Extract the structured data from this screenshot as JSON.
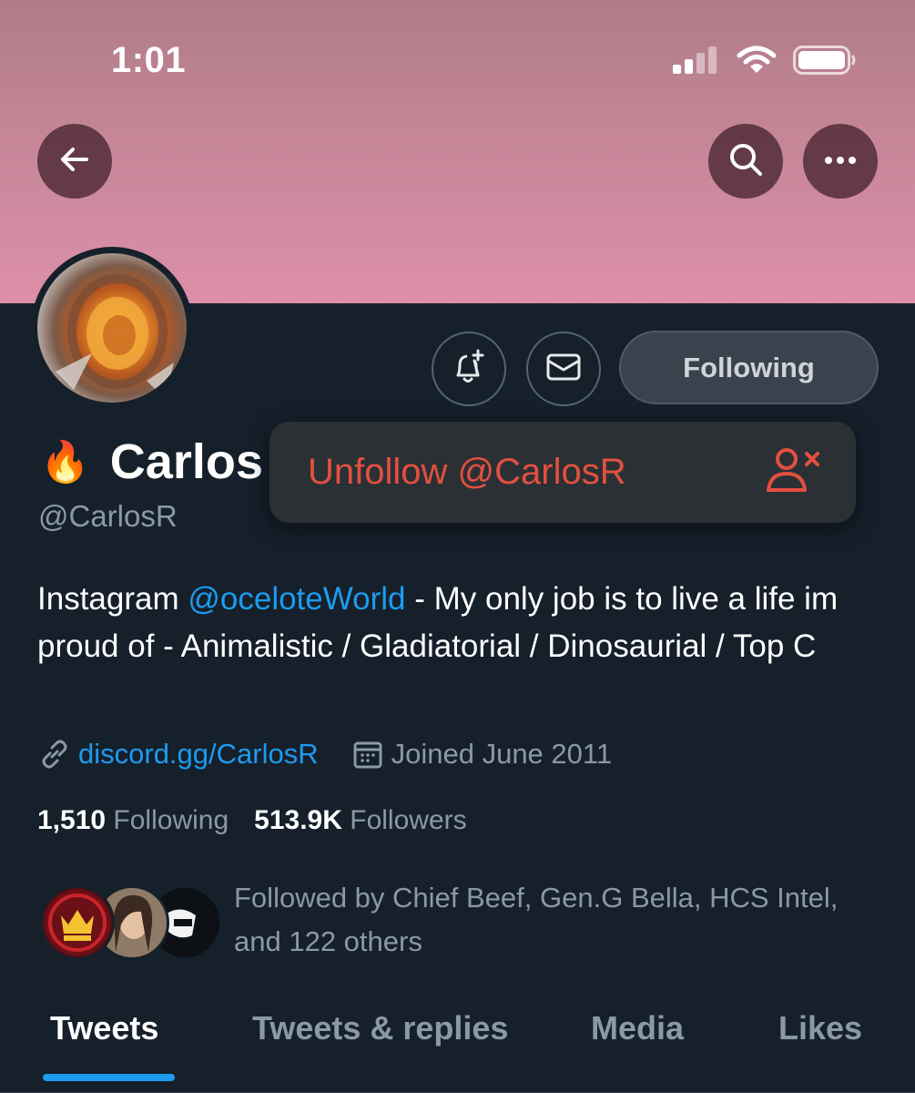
{
  "status_bar": {
    "time": "1:01",
    "icons": [
      "cellular-signal-icon",
      "wifi-icon",
      "battery-icon"
    ]
  },
  "colors": {
    "background": "#15202b",
    "banner": "#c9889b",
    "accent": "#1d9bf0",
    "danger": "#e3503f",
    "muted": "#8b98a5"
  },
  "header": {
    "back_icon": "arrow-left-icon",
    "search_icon": "search-icon",
    "more_icon": "more-horizontal-icon"
  },
  "profile": {
    "name_emoji": "🔥",
    "name": "Carlos",
    "handle": "@CarlosR",
    "bio_prefix": "Instagram ",
    "bio_mention": "@oceloteWorld",
    "bio_suffix": " - My only job is to live a life im proud of - Animalistic / Gladiatorial / Dinosaurial / Top C",
    "website": "discord.gg/CarlosR",
    "joined": "Joined June 2011"
  },
  "actions": {
    "notify_icon": "bell-plus-icon",
    "message_icon": "envelope-icon",
    "following_label": "Following"
  },
  "popup": {
    "label": "Unfollow @CarlosR",
    "icon": "person-remove-icon"
  },
  "stats": {
    "following_count": "1,510",
    "following_label": "Following",
    "followers_count": "513.9K",
    "followers_label": "Followers"
  },
  "followed_by": {
    "text": "Followed by Chief Beef, Gen.G Bella, HCS Intel, and 122 others"
  },
  "tabs": [
    {
      "label": "Tweets",
      "active": true
    },
    {
      "label": "Tweets & replies",
      "active": false
    },
    {
      "label": "Media",
      "active": false
    },
    {
      "label": "Likes",
      "active": false
    }
  ]
}
